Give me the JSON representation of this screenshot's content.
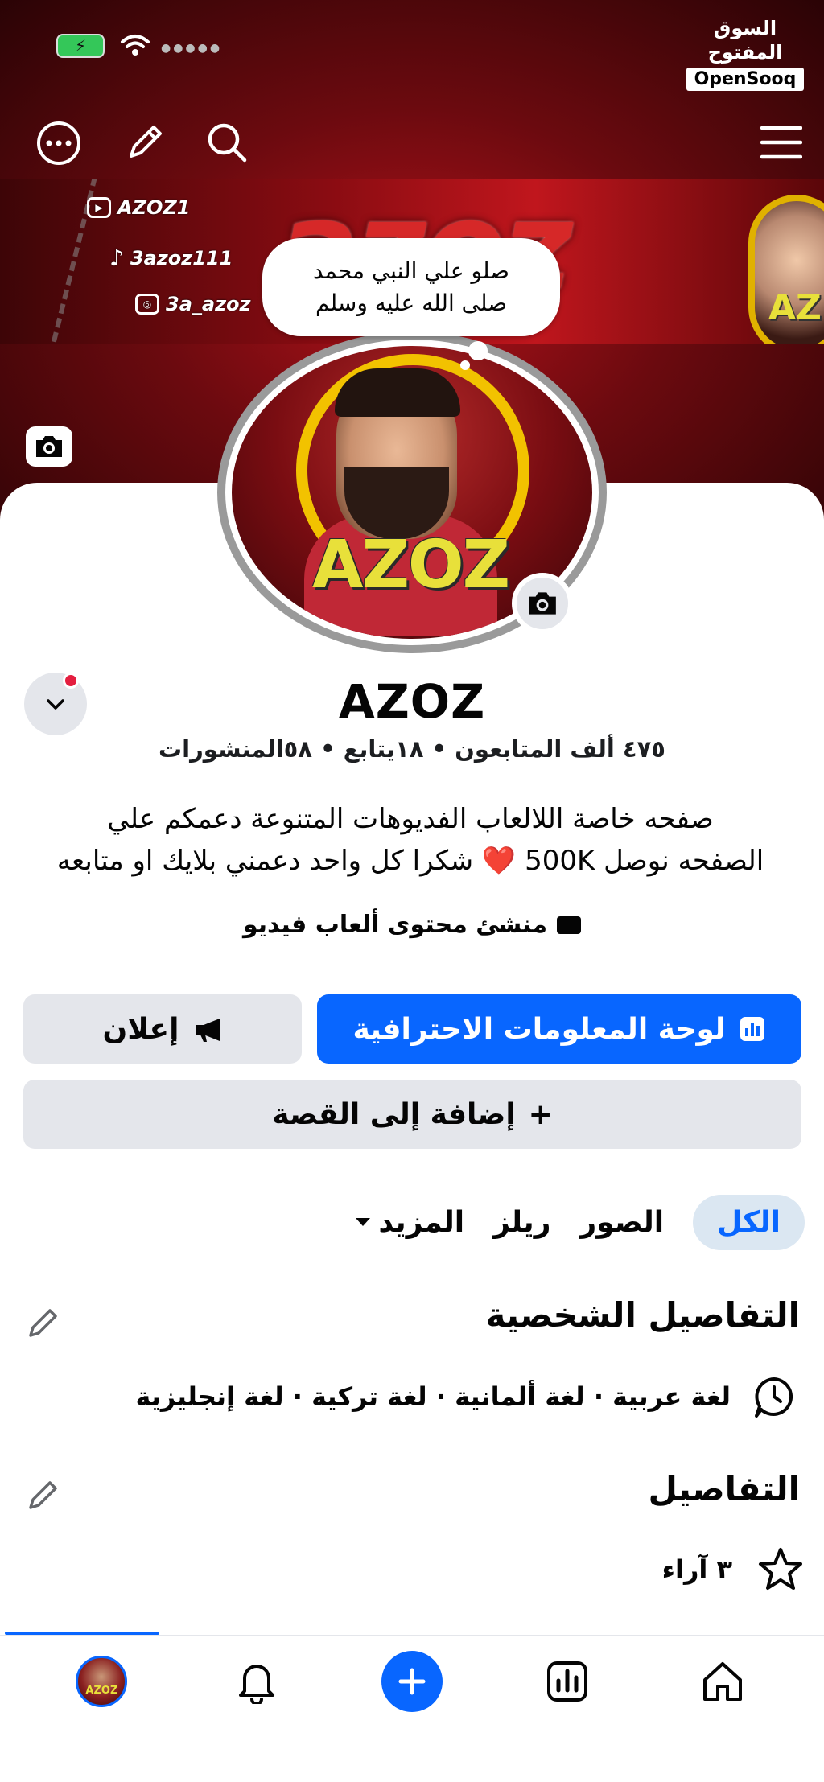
{
  "status_bar": {
    "battery_icon": "battery-charging-icon",
    "wifi_icon": "wifi-icon",
    "watermark_ar": "السوق المفتوح",
    "watermark_en": "OpenSooq"
  },
  "header": {
    "menu_icon": "hamburger-menu-icon",
    "search_icon": "search-icon",
    "edit_icon": "pencil-icon",
    "more_icon": "more-options-icon"
  },
  "cover": {
    "big_text": "azoz",
    "socials": [
      {
        "platform": "youtube",
        "handle": "AZOZ1"
      },
      {
        "platform": "tiktok",
        "handle": "3azoz111"
      },
      {
        "platform": "instagram",
        "handle": "3a_azoz"
      }
    ],
    "small_logo": "AZ"
  },
  "bubble": {
    "line1": "صلو علي النبي محمد",
    "line2": "صلى الله عليه وسلم"
  },
  "profile": {
    "avatar_logo": "AZOZ",
    "name": "AZOZ",
    "stats": "٤٧٥ ألف المتابعون • ١٨يتابع • ٥٨المنشورات",
    "bio_line1": "صفحه خاصة اللالعاب الفديوهات المتنوعة دعمكم علي",
    "bio_line2": "الصفحه نوصل 500K ❤️ شكرا كل واحد دعمني بلايك او متابعه",
    "category": "منشئ محتوى ألعاب فيديو"
  },
  "buttons": {
    "dashboard": "لوحة المعلومات الاحترافية",
    "ad": "إعلان",
    "add_story": "إضافة إلى القصة",
    "add_story_plus": "+"
  },
  "tabs": [
    {
      "label": "الكل",
      "active": true
    },
    {
      "label": "الصور",
      "active": false
    },
    {
      "label": "ريلز",
      "active": false
    },
    {
      "label": "المزيد",
      "active": false
    }
  ],
  "personal_details": {
    "title": "التفاصيل الشخصية",
    "languages": "لغة عربية · لغة ألمانية · لغة تركية · لغة إنجليزية"
  },
  "details": {
    "title": "التفاصيل",
    "reviews": "٣ آراء"
  },
  "bottom_nav": {
    "items": [
      "profile-avatar",
      "bell-icon",
      "create-plus-icon",
      "dashboard-chart-icon",
      "home-icon"
    ],
    "avatar_label": "AZOZ"
  },
  "colors": {
    "accent": "#0866ff",
    "button_gray": "#e4e6eb",
    "tab_active_bg": "#dbe7f2",
    "notification_red": "#e41e3f"
  }
}
